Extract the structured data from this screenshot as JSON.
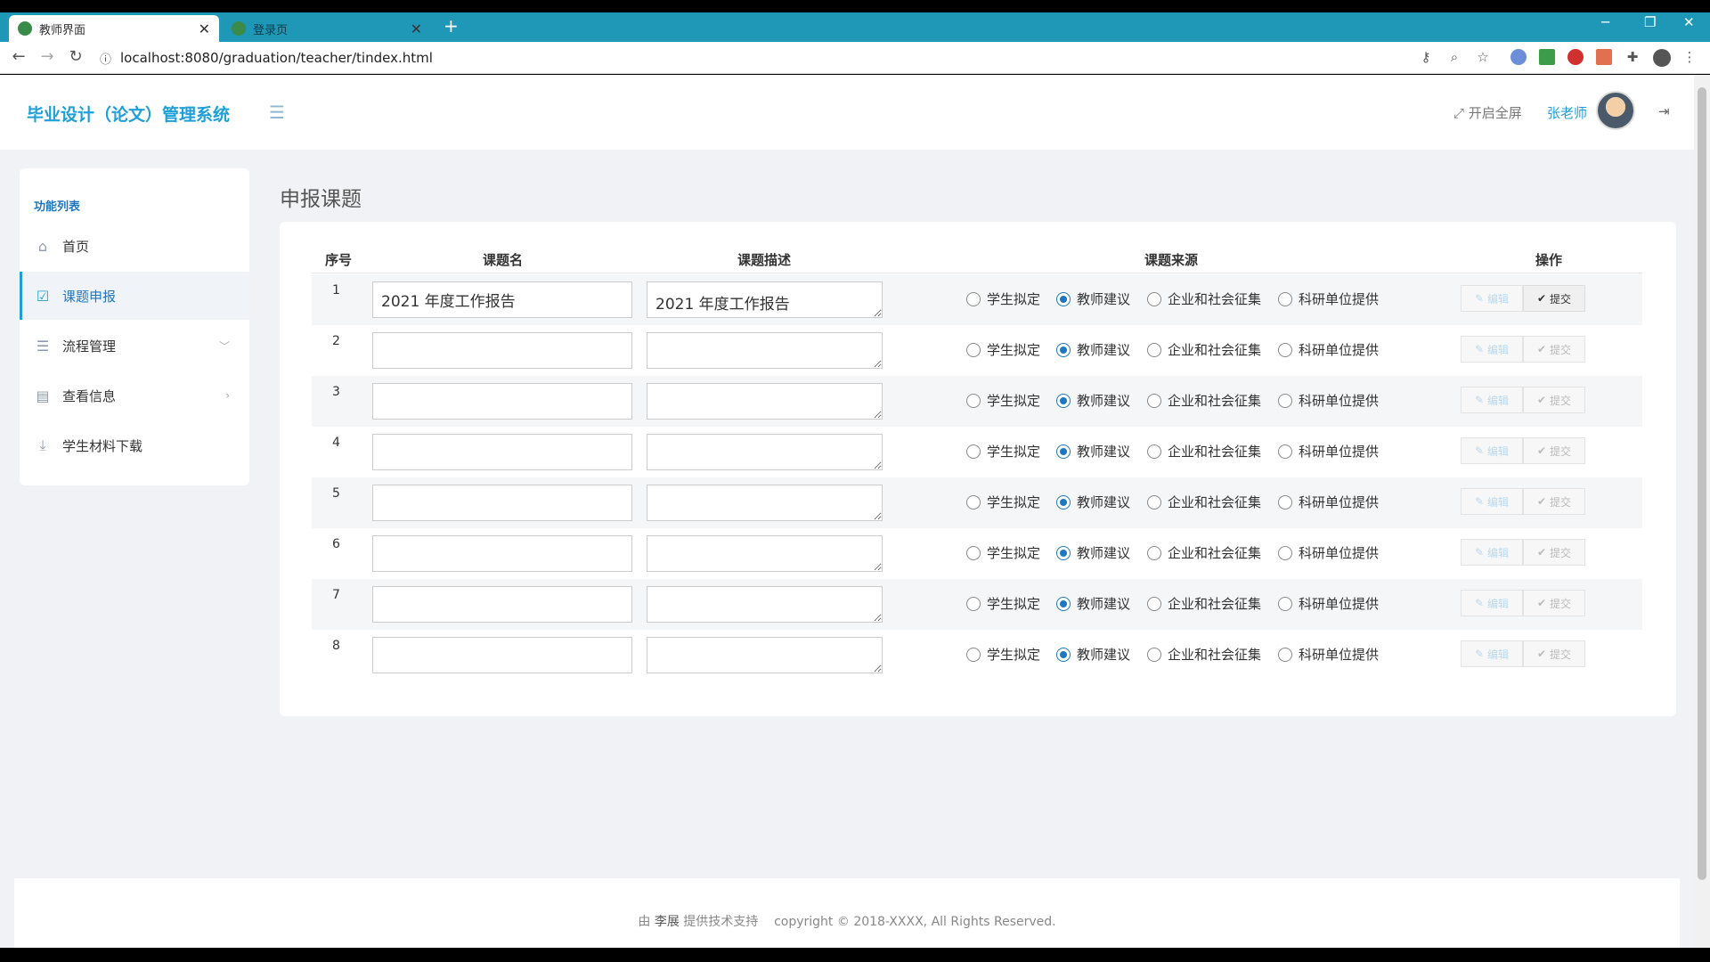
{
  "browser": {
    "tabs": [
      {
        "title": "教师界面",
        "active": true
      },
      {
        "title": "登录页",
        "active": false
      }
    ],
    "new_tab": "+",
    "url": "localhost:8080/graduation/teacher/tindex.html"
  },
  "header": {
    "brand": "毕业设计（论文）管理系统",
    "fullscreen": "开启全屏",
    "username": "张老师"
  },
  "sidebar": {
    "title": "功能列表",
    "items": [
      {
        "label": "首页"
      },
      {
        "label": "课题申报"
      },
      {
        "label": "流程管理"
      },
      {
        "label": "查看信息"
      },
      {
        "label": "学生材料下载"
      }
    ]
  },
  "content": {
    "title": "申报课题",
    "columns": [
      "序号",
      "课题名",
      "课题描述",
      "课题来源",
      "操作"
    ],
    "source_options": [
      "学生拟定",
      "教师建议",
      "企业和社会征集",
      "科研单位提供"
    ],
    "selected_source": "教师建议",
    "edit_label": "编辑",
    "submit_label": "提交",
    "rows": [
      {
        "index": "1",
        "name": "2021 年度工作报告",
        "desc": "2021 年度工作报告"
      },
      {
        "index": "2",
        "name": "",
        "desc": ""
      },
      {
        "index": "3",
        "name": "",
        "desc": ""
      },
      {
        "index": "4",
        "name": "",
        "desc": ""
      },
      {
        "index": "5",
        "name": "",
        "desc": ""
      },
      {
        "index": "6",
        "name": "",
        "desc": ""
      },
      {
        "index": "7",
        "name": "",
        "desc": ""
      },
      {
        "index": "8",
        "name": "",
        "desc": ""
      }
    ]
  },
  "footer": {
    "prefix": "由",
    "author": "李展",
    "suffix": "提供技术支持",
    "copyright": "copyright © 2018-XXXX, All Rights Reserved."
  },
  "colors": {
    "accent": "#1e9fd8",
    "tabstrip": "#1f98b8",
    "radio": "#1e77c0"
  }
}
